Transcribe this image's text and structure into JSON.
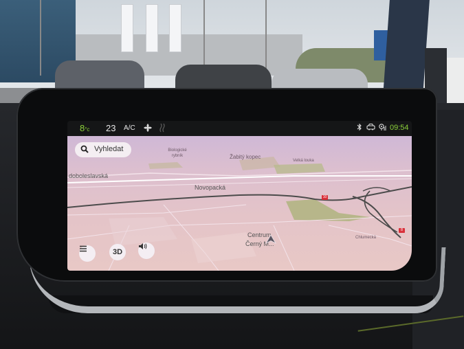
{
  "status_bar": {
    "left_temp": "8",
    "left_temp_unit": "°c",
    "right_temp": "23",
    "ac_label": "A/C",
    "fan_icon": "fan-icon",
    "seat_icon": "seat-heat-icon",
    "bluetooth_icon": "bluetooth-icon",
    "car_icon": "car-connect-icon",
    "signal_icon": "signal-icon",
    "time": "09:54",
    "accent": "#8cd13a"
  },
  "map": {
    "search_label": "Vyhledat",
    "search_icon": "search-icon",
    "place_labels": [
      "Biologické rybník",
      "Žabitý kopec",
      "Velká louka",
      "doboleslavská",
      "Novopacká",
      "Centrum",
      "Černý M...",
      "Chlumecká"
    ],
    "route_badges": [
      "10",
      "8"
    ],
    "buttons": {
      "menu_icon": "menu-icon",
      "view_mode": "3D",
      "sound_icon": "speaker-icon"
    },
    "colors": {
      "map_bg": "#e4c4c8",
      "park": "#b7b68a",
      "road": "#ffffff",
      "highway": "#4b4b4b"
    }
  }
}
